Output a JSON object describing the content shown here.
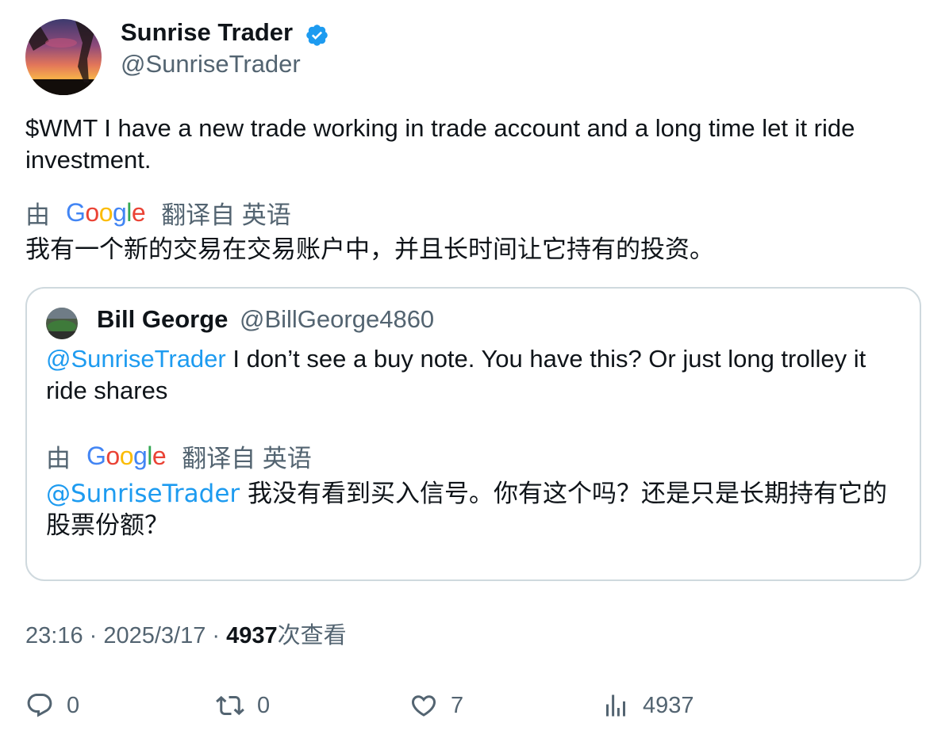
{
  "author": {
    "name": "Sunrise Trader",
    "handle": "@SunriseTrader",
    "verified_icon": "verified-badge-icon"
  },
  "tweet": {
    "text": "$WMT I have a new trade working in trade account and a long time let it ride investment.",
    "translate_prefix": "由",
    "translate_suffix": "翻译自 英语",
    "translated_text": "我有一个新的交易在交易账户中，并且长时间让它持有的投资。"
  },
  "quote": {
    "name": "Bill George",
    "handle": "@BillGeorge4860",
    "mention": "@SunriseTrader",
    "text": " I don’t see a buy note. You have this? Or just long trolley it ride shares",
    "translate_prefix": "由",
    "translate_suffix": "翻译自 英语",
    "translated_text": " 我没有看到买入信号。你有这个吗？还是只是长期持有它的股票份额？"
  },
  "meta": {
    "time": "23:16",
    "separator": " · ",
    "date": "2025/3/17",
    "views_count": "4937",
    "views_label": "次查看"
  },
  "actions": {
    "reply_count": "0",
    "retweet_count": "0",
    "like_count": "7",
    "views_count": "4937"
  },
  "google_logo": "Google",
  "colors": {
    "accent": "#1d9bf0",
    "muted": "#536471",
    "text": "#0f1419",
    "border": "#cfd9de"
  }
}
